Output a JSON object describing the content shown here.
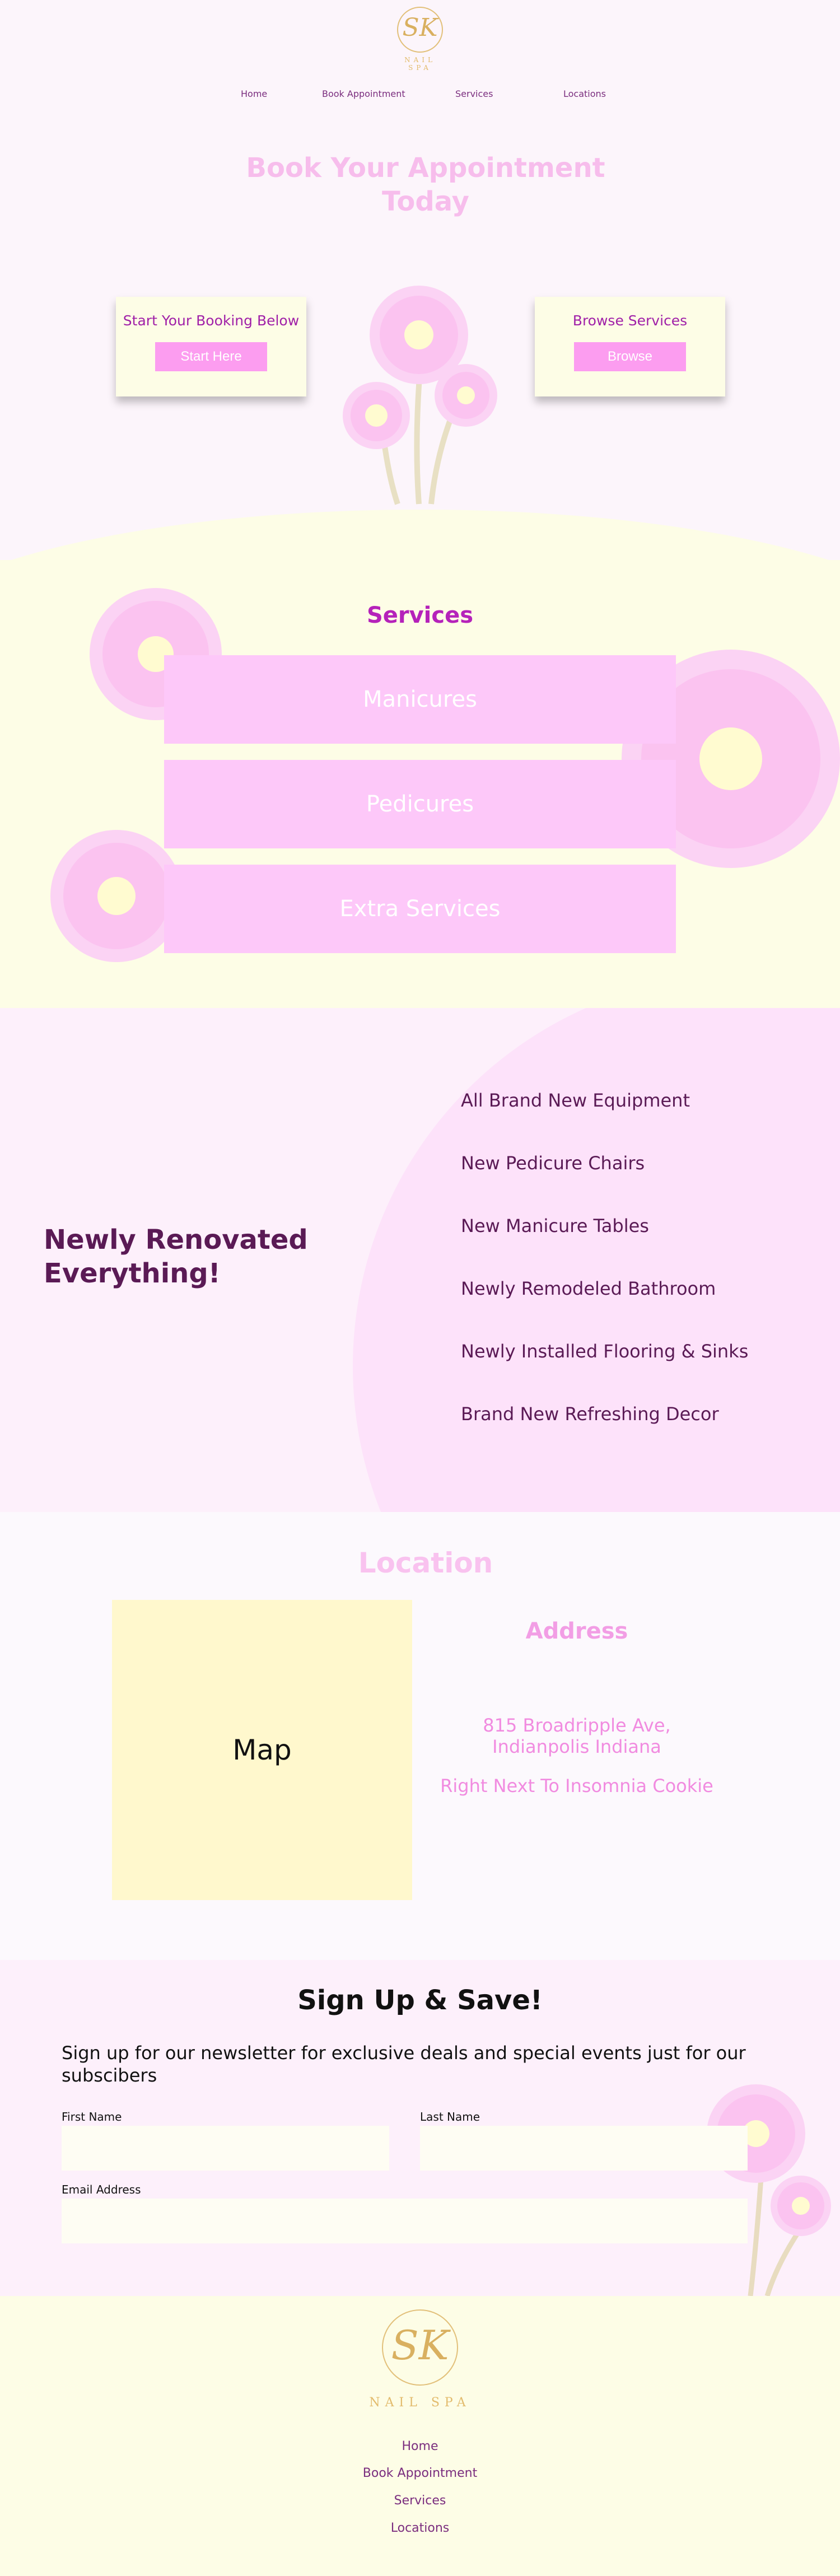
{
  "brand": {
    "monogram": "SK",
    "name": "NAIL SPA",
    "gold": "#e2c07a"
  },
  "nav": {
    "items": [
      "Home",
      "Book Appointment",
      "Services",
      "Locations"
    ]
  },
  "hero": {
    "title": "Book Your Appointment Today",
    "booking_card": {
      "title": "Start Your Booking Below",
      "button": "Start Here"
    },
    "services_card": {
      "title": "Browse Services",
      "button": "Browse"
    }
  },
  "services": {
    "title": "Services",
    "items": [
      "Manicures",
      "Pedicures",
      "Extra Services"
    ]
  },
  "renovated": {
    "title": "Newly Renovated Everything!",
    "features": [
      "All Brand New Equipment",
      "New Pedicure Chairs",
      "New Manicure Tables",
      "Newly Remodeled Bathroom",
      "Newly Installed Flooring & Sinks",
      "Brand New Refreshing Decor"
    ]
  },
  "location": {
    "title": "Location",
    "map_label": "Map",
    "address_title": "Address",
    "address": "815 Broadripple Ave, Indianpolis Indiana",
    "landmark": "Right Next To Insomnia Cookie"
  },
  "signup": {
    "title": "Sign Up & Save!",
    "description": "Sign up for our newsletter for exclusive deals and special events just for our subscibers",
    "first_name_label": "First Name",
    "first_name_value": "",
    "last_name_label": "Last Name",
    "last_name_value": "",
    "email_label": "Email Address",
    "email_value": ""
  },
  "footer": {
    "links": [
      "Home",
      "Book Appointment",
      "Services",
      "Locations"
    ]
  },
  "colors": {
    "accent_pink": "#fc9df0",
    "light_pink": "#fdc8f9",
    "purple": "#b522ba",
    "dark_purple": "#5a1a55",
    "cream": "#fdfde6"
  }
}
